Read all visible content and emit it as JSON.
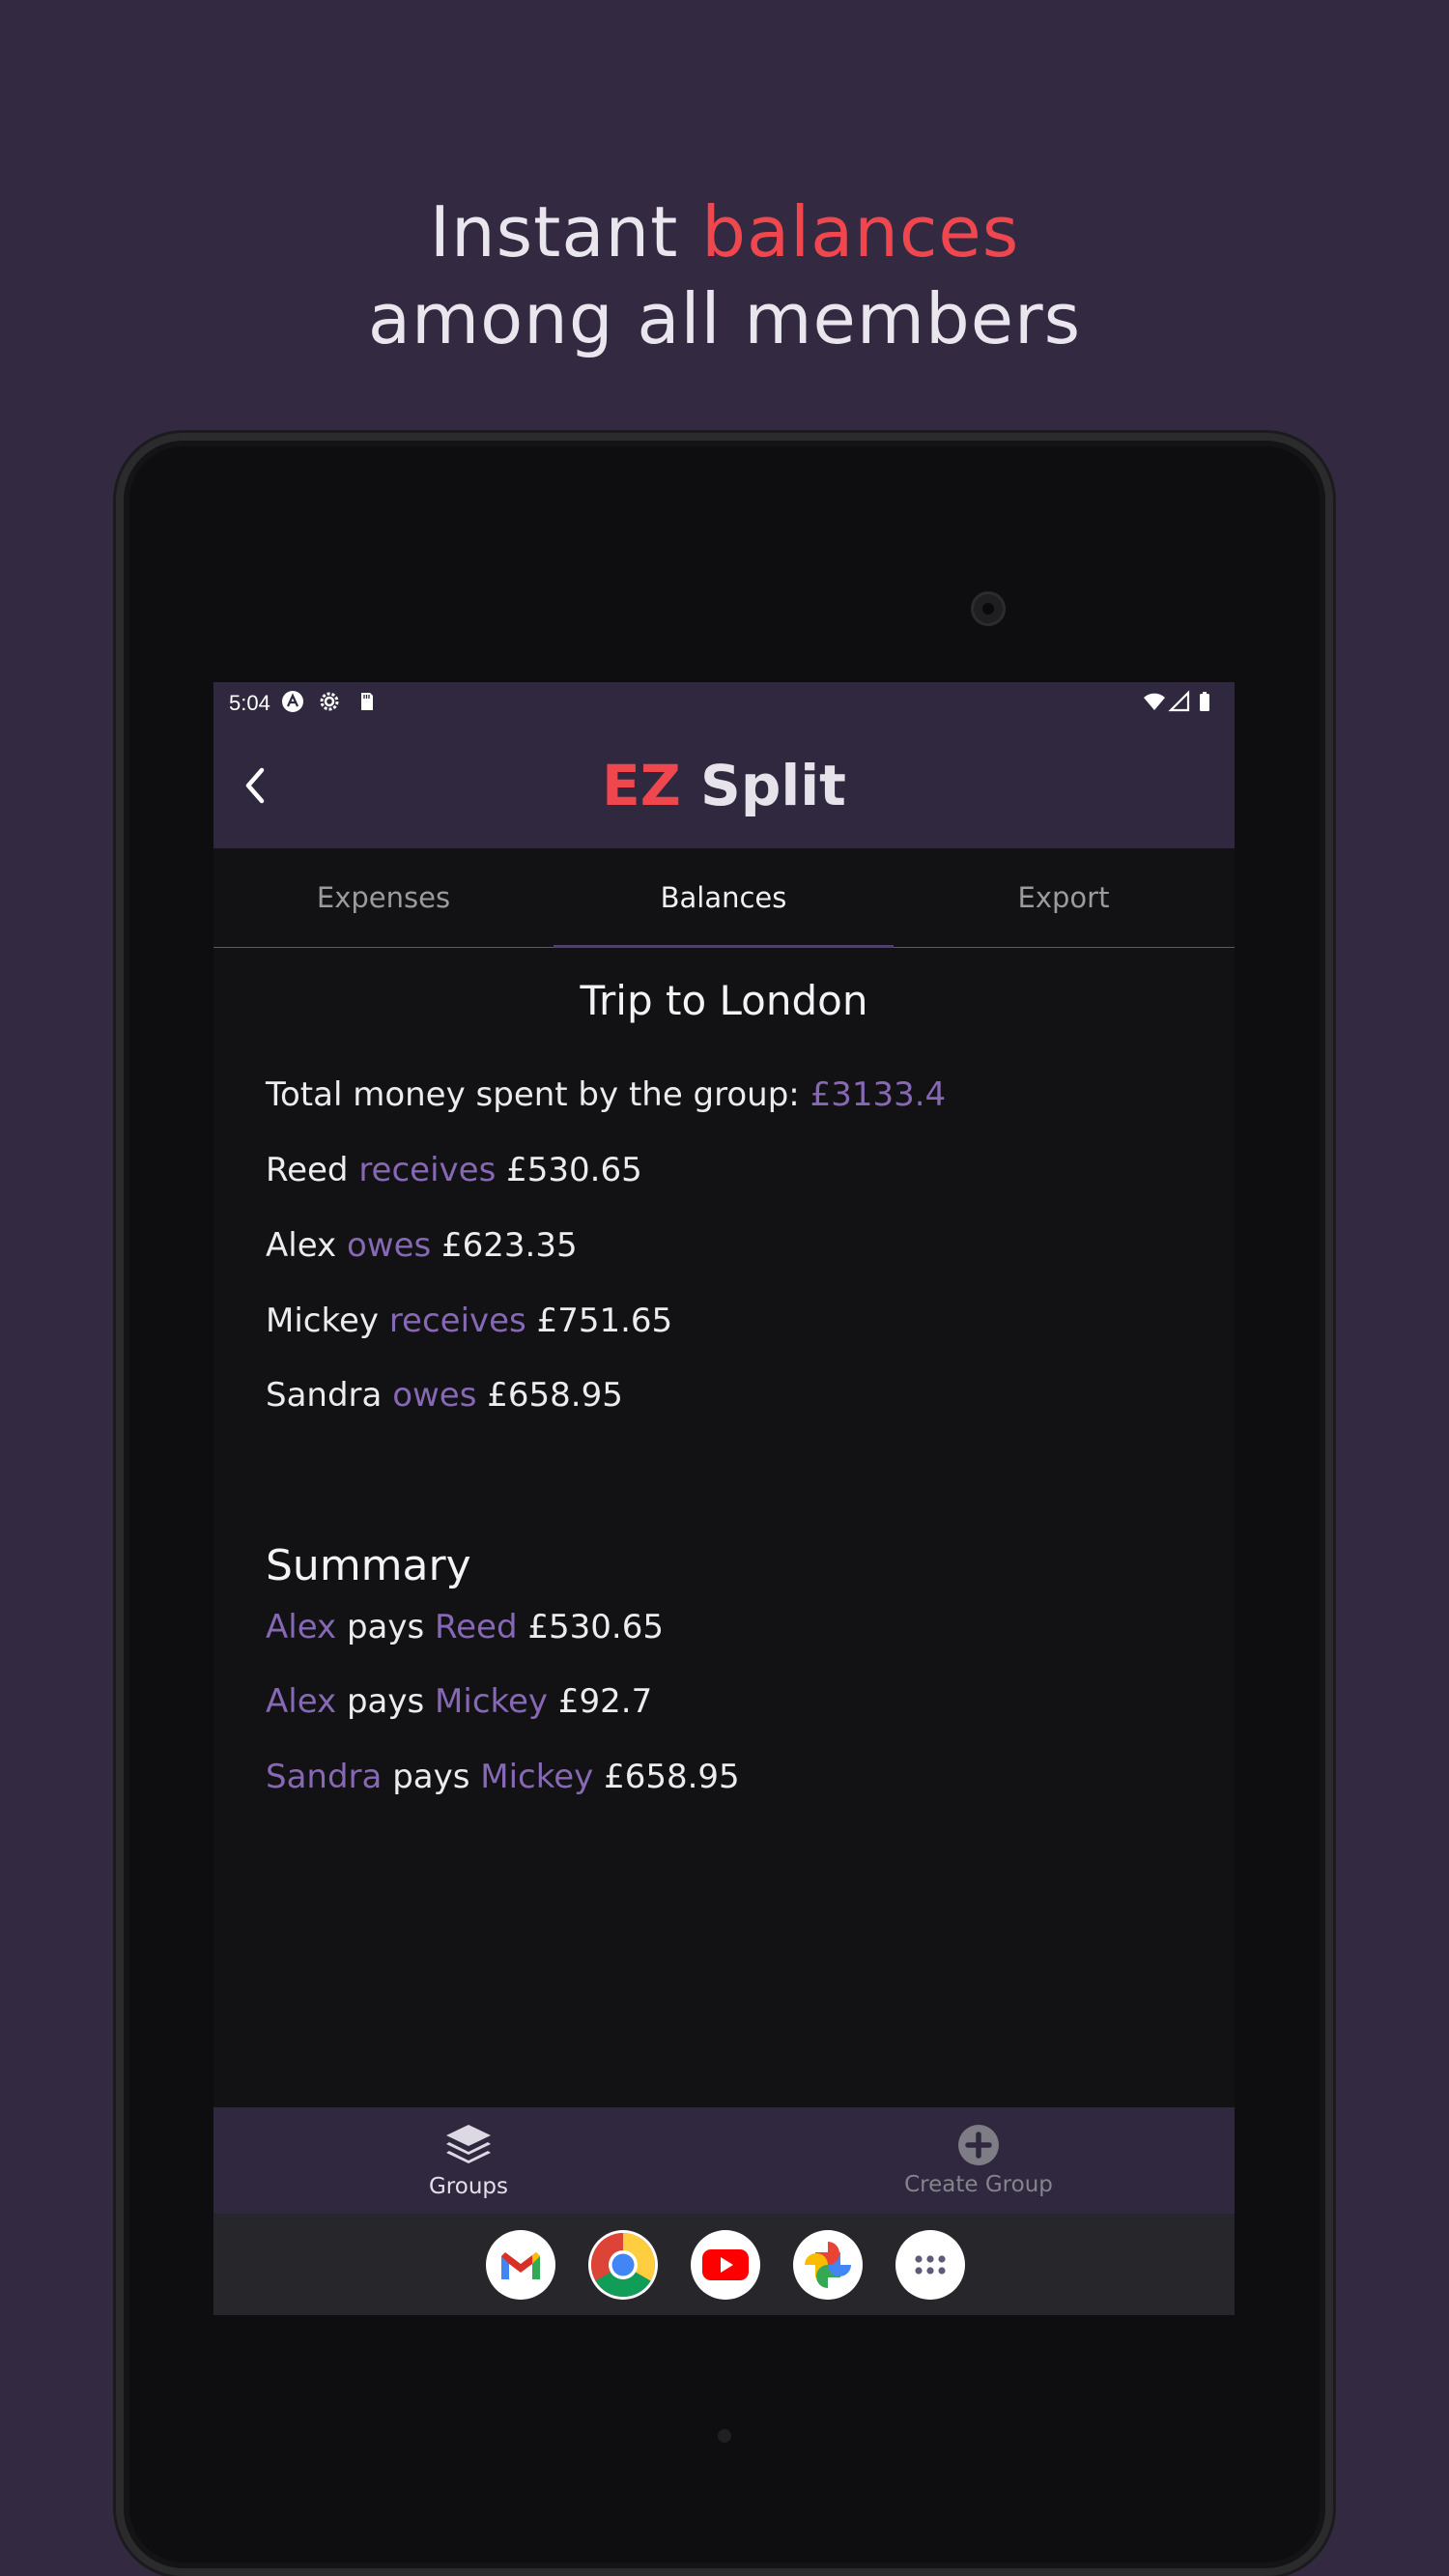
{
  "promo": {
    "line1_prefix": "Instant",
    "line1_accent": "balances",
    "line2": "among all members"
  },
  "status_bar": {
    "time": "5:04"
  },
  "app_bar": {
    "title_accent": "EZ",
    "title_rest": "Split"
  },
  "tabs": [
    {
      "label": "Expenses"
    },
    {
      "label": "Balances"
    },
    {
      "label": "Export"
    }
  ],
  "active_tab": "Balances",
  "group": {
    "title": "Trip to London",
    "total_label": "Total money spent by the group:",
    "total_value": "£3133.4"
  },
  "balances": [
    {
      "name": "Reed",
      "action": "receives",
      "amount": "£530.65"
    },
    {
      "name": "Alex",
      "action": "owes",
      "amount": "£623.35"
    },
    {
      "name": "Mickey",
      "action": "receives",
      "amount": "£751.65"
    },
    {
      "name": "Sandra",
      "action": "owes",
      "amount": "£658.95"
    }
  ],
  "summary": {
    "title": "Summary",
    "items": [
      {
        "from": "Alex",
        "verb": "pays",
        "to": "Reed",
        "amount": "£530.65"
      },
      {
        "from": "Alex",
        "verb": "pays",
        "to": "Mickey",
        "amount": "£92.7"
      },
      {
        "from": "Sandra",
        "verb": "pays",
        "to": "Mickey",
        "amount": "£658.95"
      }
    ]
  },
  "bottom_nav": [
    {
      "label": "Groups",
      "icon": "layers-icon"
    },
    {
      "label": "Create Group",
      "icon": "add-circle-icon"
    }
  ],
  "dock": [
    {
      "icon": "gmail-icon"
    },
    {
      "icon": "chrome-icon"
    },
    {
      "icon": "youtube-icon"
    },
    {
      "icon": "photos-icon"
    },
    {
      "icon": "app-drawer-icon"
    }
  ],
  "colors": {
    "background": "#332a42",
    "accent_red": "#f0474f",
    "accent_purple": "#8668b5",
    "app_bar": "#30283f"
  }
}
